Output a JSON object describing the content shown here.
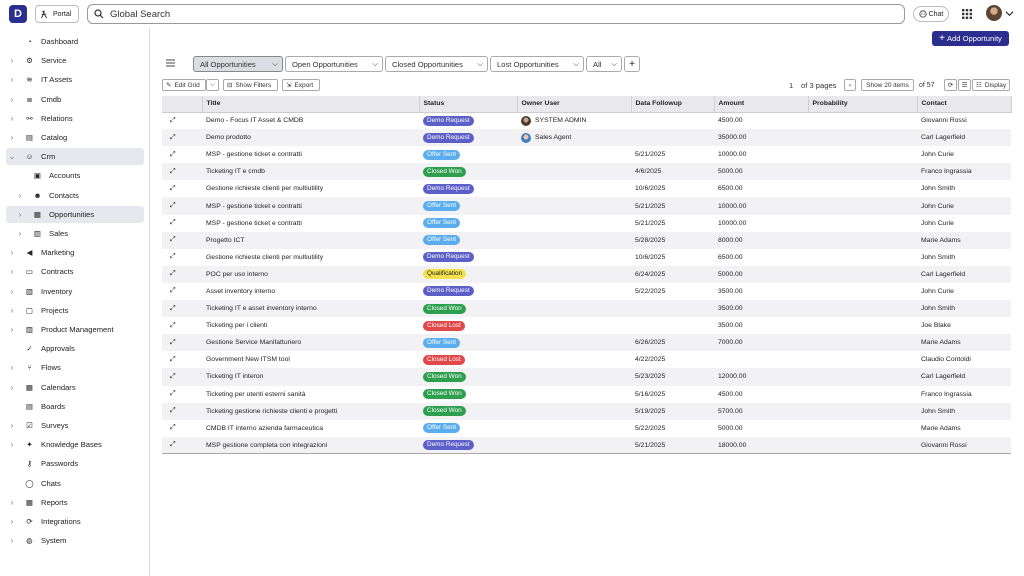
{
  "topbar": {
    "logo_letter": "D",
    "portal_label": "Portal",
    "search_placeholder": "Global Search",
    "chat_label": "Chat"
  },
  "sidebar": {
    "items": [
      {
        "label": "Dashboard",
        "icon": "dashboard-icon",
        "chevron": false,
        "level": 0,
        "active": false
      },
      {
        "label": "Service",
        "icon": "service-icon",
        "chevron": true,
        "level": 0,
        "active": false
      },
      {
        "label": "IT Assets",
        "icon": "wifi-icon",
        "chevron": true,
        "level": 0,
        "active": false
      },
      {
        "label": "Cmdb",
        "icon": "database-icon",
        "chevron": true,
        "level": 0,
        "active": false
      },
      {
        "label": "Relations",
        "icon": "relations-icon",
        "chevron": true,
        "level": 0,
        "active": false
      },
      {
        "label": "Catalog",
        "icon": "catalog-icon",
        "chevron": true,
        "level": 0,
        "active": false
      },
      {
        "label": "Crm",
        "icon": "crm-icon",
        "chevron": "open",
        "level": 0,
        "active": true
      },
      {
        "label": "Accounts",
        "icon": "accounts-icon",
        "chevron": false,
        "level": 1,
        "active": false
      },
      {
        "label": "Contacts",
        "icon": "contacts-icon",
        "chevron": true,
        "level": 1,
        "active": false
      },
      {
        "label": "Opportunities",
        "icon": "opportunities-icon",
        "chevron": true,
        "level": 1,
        "active": true
      },
      {
        "label": "Sales",
        "icon": "sales-icon",
        "chevron": true,
        "level": 1,
        "active": false
      },
      {
        "label": "Marketing",
        "icon": "marketing-icon",
        "chevron": true,
        "level": 0,
        "active": false
      },
      {
        "label": "Contracts",
        "icon": "contracts-icon",
        "chevron": true,
        "level": 0,
        "active": false
      },
      {
        "label": "Inventory",
        "icon": "inventory-icon",
        "chevron": true,
        "level": 0,
        "active": false
      },
      {
        "label": "Projects",
        "icon": "projects-icon",
        "chevron": true,
        "level": 0,
        "active": false
      },
      {
        "label": "Product Management",
        "icon": "product-icon",
        "chevron": true,
        "level": 0,
        "active": false
      },
      {
        "label": "Approvals",
        "icon": "approvals-icon",
        "chevron": false,
        "level": 0,
        "active": false
      },
      {
        "label": "Flows",
        "icon": "flows-icon",
        "chevron": true,
        "level": 0,
        "active": false
      },
      {
        "label": "Calendars",
        "icon": "calendar-icon",
        "chevron": true,
        "level": 0,
        "active": false
      },
      {
        "label": "Boards",
        "icon": "boards-icon",
        "chevron": false,
        "level": 0,
        "active": false
      },
      {
        "label": "Surveys",
        "icon": "surveys-icon",
        "chevron": true,
        "level": 0,
        "active": false
      },
      {
        "label": "Knowledge Bases",
        "icon": "knowledge-icon",
        "chevron": true,
        "level": 0,
        "active": false
      },
      {
        "label": "Passwords",
        "icon": "key-icon",
        "chevron": false,
        "level": 0,
        "active": false
      },
      {
        "label": "Chats",
        "icon": "chat-icon",
        "chevron": false,
        "level": 0,
        "active": false
      },
      {
        "label": "Reports",
        "icon": "reports-icon",
        "chevron": true,
        "level": 0,
        "active": false
      },
      {
        "label": "Integrations",
        "icon": "integrations-icon",
        "chevron": true,
        "level": 0,
        "active": false
      },
      {
        "label": "System",
        "icon": "globe-icon",
        "chevron": true,
        "level": 0,
        "active": false
      }
    ]
  },
  "header": {
    "add_button": "Add Opportunity"
  },
  "tabs": [
    {
      "label": "All Opportunities",
      "active": true
    },
    {
      "label": "Open Opportunities",
      "active": false
    },
    {
      "label": "Closed Opportunities",
      "active": false
    },
    {
      "label": "Lost Opportunities",
      "active": false
    },
    {
      "label": "All",
      "active": false
    }
  ],
  "toolbar": {
    "edit_grid": "Edit Grid",
    "show_filters": "Show Filters",
    "export": "Export",
    "page_current": "1",
    "page_total_text": "of 3 pages",
    "show_items": "Show 20 items",
    "total_text": "of 57",
    "display": "Display"
  },
  "table": {
    "columns": [
      "Title",
      "Status",
      "Owner User",
      "Data Followup",
      "Amount",
      "Probability",
      "Contact"
    ],
    "rows": [
      {
        "title": "Demo - Focus IT Asset & CMDB",
        "status": "Demo Request",
        "owner": "SYSTEM ADMIN",
        "followup": "",
        "amount": "4500.00",
        "probability": "",
        "contact": "Giovanni Rossi"
      },
      {
        "title": "Demo prodotto",
        "status": "Demo Request",
        "owner": "Sales Agent",
        "followup": "",
        "amount": "35000.00",
        "probability": "",
        "contact": "Carl Lagerfield"
      },
      {
        "title": "MSP - gestione ticket e contratti",
        "status": "Offer Sent",
        "owner": "",
        "followup": "5/21/2025",
        "amount": "10000.00",
        "probability": "",
        "contact": "John Curie"
      },
      {
        "title": "Ticketing IT e cmdb",
        "status": "Closed Won",
        "owner": "",
        "followup": "4/6/2025",
        "amount": "5000.00",
        "probability": "",
        "contact": "Franco Ingrassia"
      },
      {
        "title": "Gestione richieste clienti per multiutility",
        "status": "Demo Request",
        "owner": "",
        "followup": "10/6/2025",
        "amount": "6500.00",
        "probability": "",
        "contact": "John Smith"
      },
      {
        "title": "MSP - gestione ticket e contratti",
        "status": "Offer Sent",
        "owner": "",
        "followup": "5/21/2025",
        "amount": "10000.00",
        "probability": "",
        "contact": "John Curie"
      },
      {
        "title": "MSP - gestione ticket e contratti",
        "status": "Offer Sent",
        "owner": "",
        "followup": "5/21/2025",
        "amount": "10000.00",
        "probability": "",
        "contact": "John Curie"
      },
      {
        "title": "Progetto ICT",
        "status": "Offer Sent",
        "owner": "",
        "followup": "5/28/2025",
        "amount": "8000.00",
        "probability": "",
        "contact": "Marie Adams"
      },
      {
        "title": "Gestione richieste clienti per multiutility",
        "status": "Demo Request",
        "owner": "",
        "followup": "10/6/2025",
        "amount": "6500.00",
        "probability": "",
        "contact": "John Smith"
      },
      {
        "title": "POC per uso interno",
        "status": "Qualification",
        "owner": "",
        "followup": "6/24/2025",
        "amount": "5000.00",
        "probability": "",
        "contact": "Carl Lagerfield"
      },
      {
        "title": "Asset inventory interno",
        "status": "Demo Request",
        "owner": "",
        "followup": "5/22/2025",
        "amount": "3500.00",
        "probability": "",
        "contact": "John Curie"
      },
      {
        "title": "Ticketing IT e asset inventory interno",
        "status": "Closed Won",
        "owner": "",
        "followup": "",
        "amount": "3500.00",
        "probability": "",
        "contact": "John Smith"
      },
      {
        "title": "Ticketing per i clienti",
        "status": "Closed Lost",
        "owner": "",
        "followup": "",
        "amount": "3500.00",
        "probability": "",
        "contact": "Joe Blake"
      },
      {
        "title": "Gestione Service Manifatturiero",
        "status": "Offer Sent",
        "owner": "",
        "followup": "6/26/2025",
        "amount": "7000.00",
        "probability": "",
        "contact": "Marie Adams"
      },
      {
        "title": "Government New ITSM tool",
        "status": "Closed Lost",
        "owner": "",
        "followup": "4/22/2025",
        "amount": "",
        "probability": "",
        "contact": "Claudio Contoldi"
      },
      {
        "title": "Ticketing IT interon",
        "status": "Closed Won",
        "owner": "",
        "followup": "5/23/2025",
        "amount": "12000.00",
        "probability": "",
        "contact": "Carl Lagerfield"
      },
      {
        "title": "Ticketing per utenti esterni sanità",
        "status": "Closed Won",
        "owner": "",
        "followup": "5/16/2025",
        "amount": "4500.00",
        "probability": "",
        "contact": "Franco Ingrassia"
      },
      {
        "title": "Ticketing gestione richieste clienti e progetti",
        "status": "Closed Won",
        "owner": "",
        "followup": "5/19/2025",
        "amount": "5700.00",
        "probability": "",
        "contact": "John Smith"
      },
      {
        "title": "CMDB IT interno azienda farmaceutica",
        "status": "Offer Sent",
        "owner": "",
        "followup": "5/22/2025",
        "amount": "5000.00",
        "probability": "",
        "contact": "Marie Adams"
      },
      {
        "title": "MSP gestione completa con integrazioni",
        "status": "Demo Request",
        "owner": "",
        "followup": "5/21/2025",
        "amount": "18000.00",
        "probability": "",
        "contact": "Giovanni Rossi"
      }
    ]
  },
  "status_colors": {
    "Demo Request": "#5b5fc7",
    "Offer Sent": "#5aaef0",
    "Closed Won": "#2e9e4f",
    "Closed Lost": "#e0484a",
    "Qualification": "#f4e04d"
  },
  "colors": {
    "brand": "#2b2d8f"
  }
}
